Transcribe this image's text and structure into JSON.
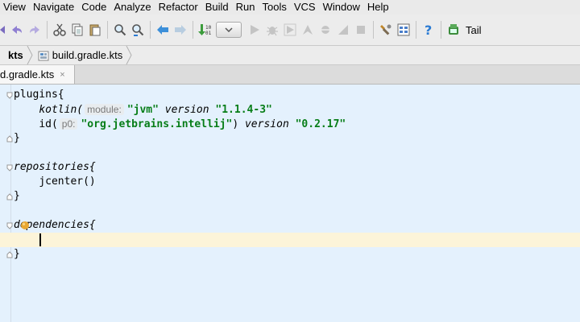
{
  "menu": [
    "View",
    "Navigate",
    "Code",
    "Analyze",
    "Refactor",
    "Build",
    "Run",
    "Tools",
    "VCS",
    "Window",
    "Help"
  ],
  "toolbar": {
    "tail_label": "Tail"
  },
  "breadcrumb": {
    "folder": "kts",
    "file": "build.gradle.kts"
  },
  "tab": {
    "label": "d.gradle.kts",
    "close": "×"
  },
  "code": {
    "l1": "plugins{",
    "l2_fn": "kotlin(",
    "l2_hint": "module:",
    "l2_str": "\"jvm\"",
    "l2_version": "version",
    "l2_ver_str": "\"1.1.4-3\"",
    "l3_fn": "id(",
    "l3_hint": "p0:",
    "l3_str": "\"org.jetbrains.intellij\"",
    "l3_close": ")",
    "l3_version": "version",
    "l3_ver_str": "\"0.2.17\"",
    "l4": "}",
    "l6": "repositories{",
    "l7": "jcenter()",
    "l8": "}",
    "l10": "dependencies{",
    "l12": "}"
  },
  "colors": {
    "editor_bg": "#e4f1fd",
    "string": "#067d17",
    "caret_row": "#fcf4d9"
  }
}
